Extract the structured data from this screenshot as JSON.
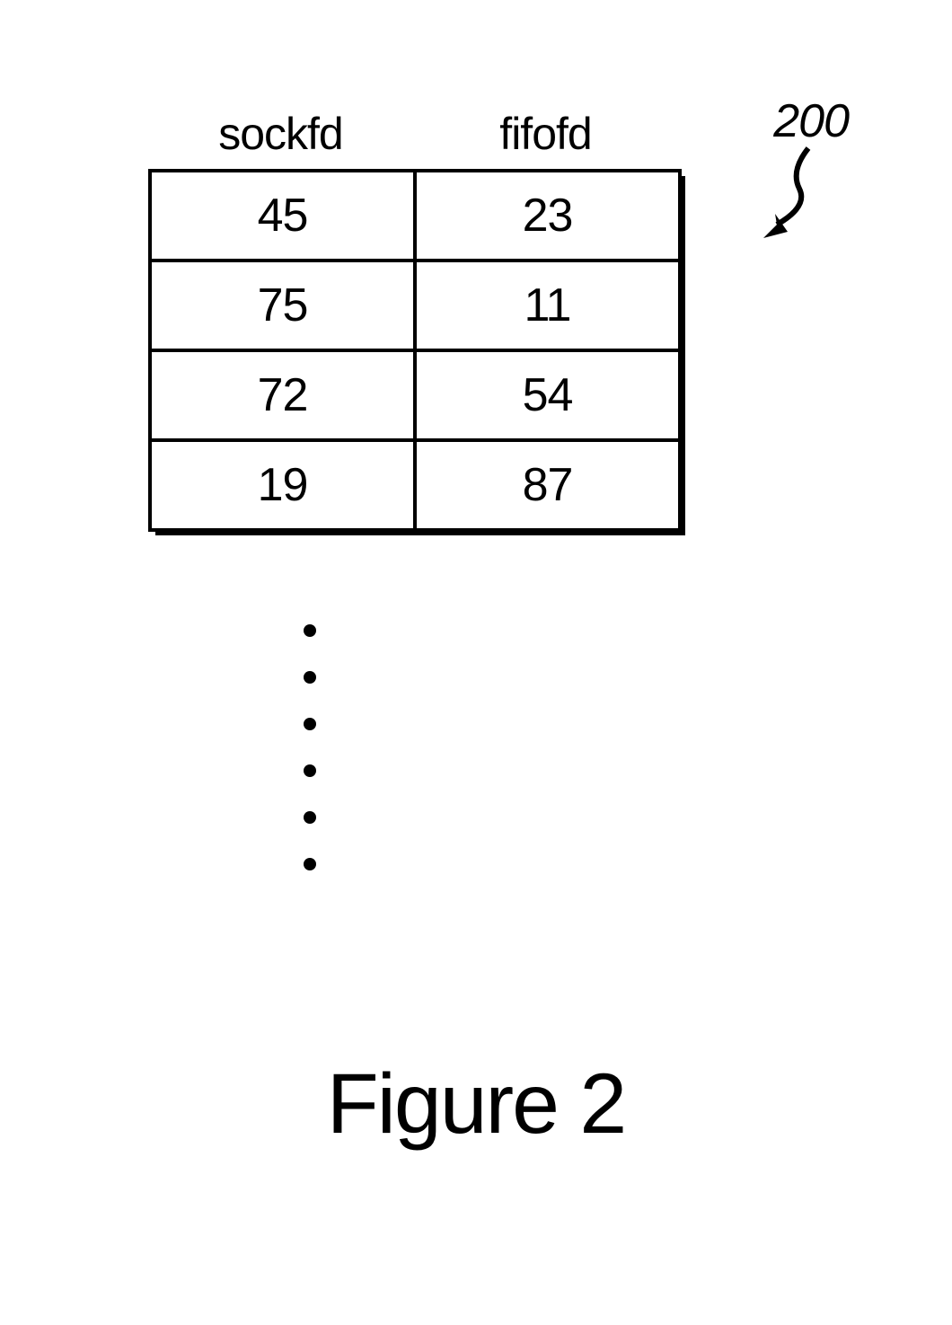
{
  "headers": {
    "col1": "sockfd",
    "col2": "fifofd"
  },
  "rows": [
    {
      "sockfd": "45",
      "fifofd": "23"
    },
    {
      "sockfd": "75",
      "fifofd": "11"
    },
    {
      "sockfd": "72",
      "fifofd": "54"
    },
    {
      "sockfd": "19",
      "fifofd": "87"
    }
  ],
  "refNumber": "200",
  "caption": "Figure 2"
}
